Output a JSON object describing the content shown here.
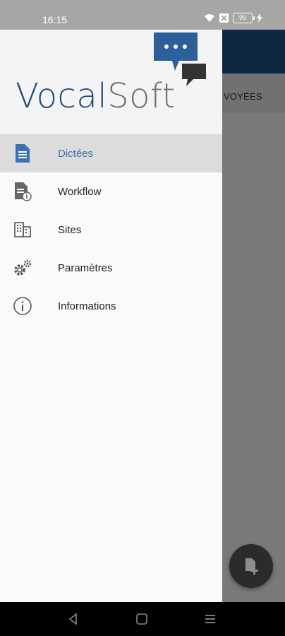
{
  "status_bar": {
    "time": "16:15",
    "battery": "99"
  },
  "app": {
    "tab_fragment": "VOYÉES"
  },
  "drawer": {
    "logo": {
      "part1": "Vocal",
      "part2": "Soft"
    },
    "items": [
      {
        "label": "Dictées",
        "icon": "document-icon",
        "active": true
      },
      {
        "label": "Workflow",
        "icon": "document-info-icon",
        "active": false
      },
      {
        "label": "Sites",
        "icon": "building-icon",
        "active": false
      },
      {
        "label": "Paramètres",
        "icon": "gears-icon",
        "active": false
      },
      {
        "label": "Informations",
        "icon": "info-circle-icon",
        "active": false
      }
    ]
  },
  "colors": {
    "accent": "#3c6fb4",
    "brand_blue": "#1f4a7c",
    "toolbar": "#1a4e86"
  }
}
